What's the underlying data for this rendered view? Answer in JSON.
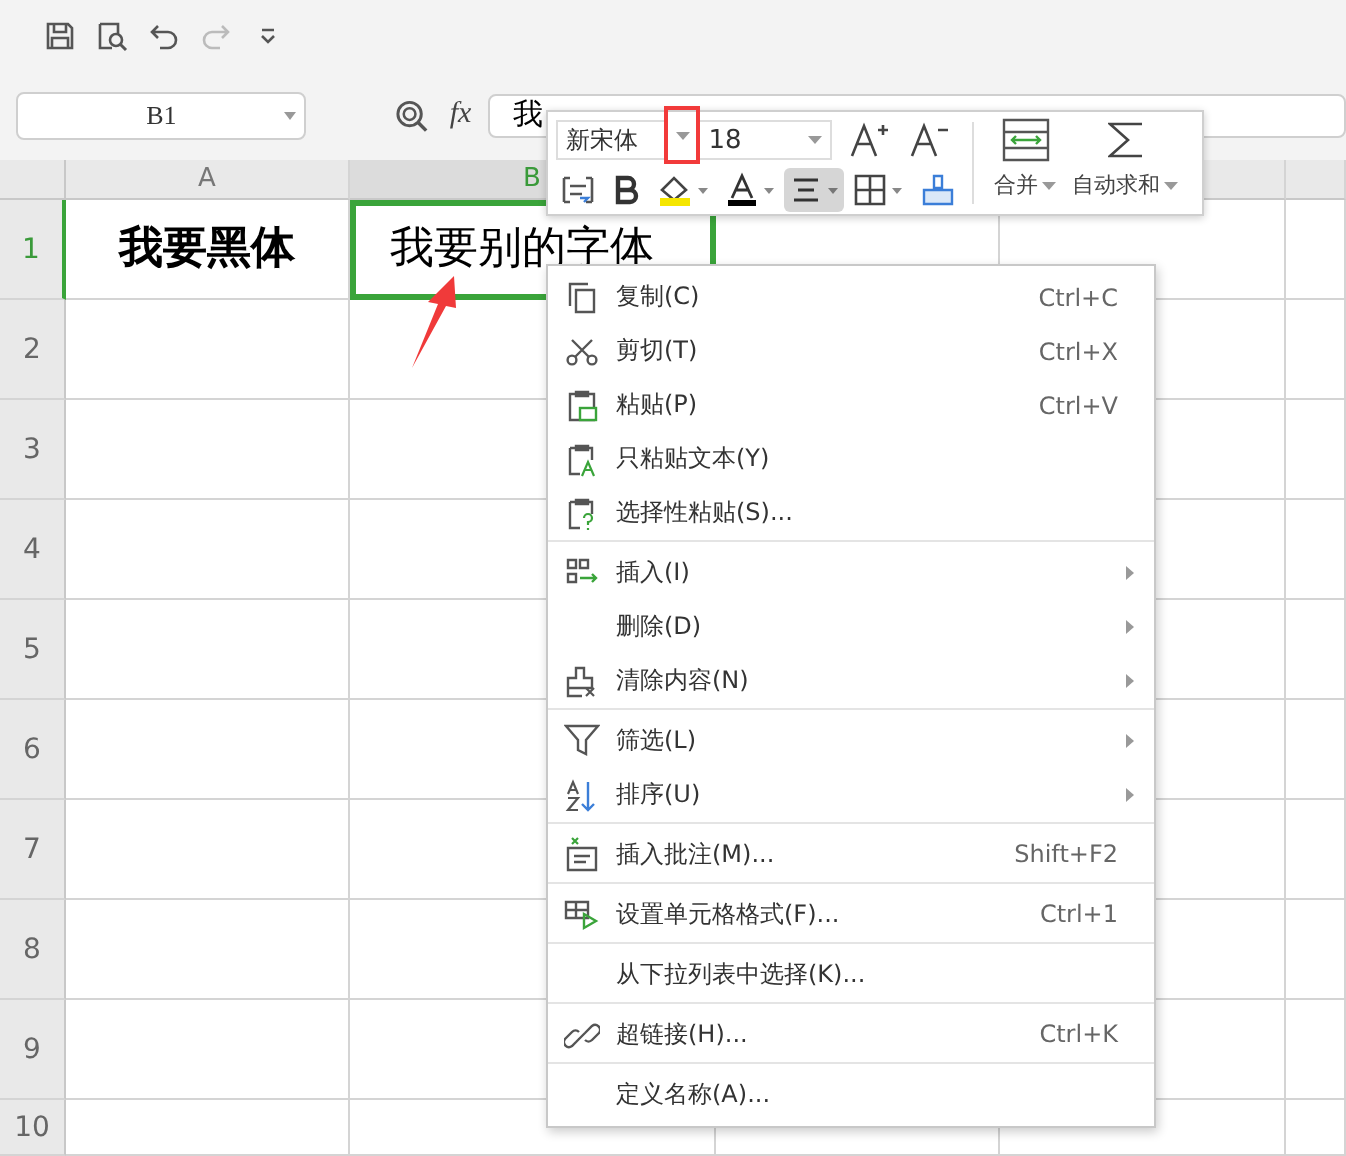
{
  "name_box": {
    "value": "B1"
  },
  "formula_bar": {
    "fx": "fx",
    "value": "我"
  },
  "columns": [
    {
      "label": "A",
      "selected": false
    },
    {
      "label": "B",
      "selected": true
    }
  ],
  "rows": [
    {
      "label": "1",
      "selected": true,
      "cells": [
        {
          "text": "我要黑体",
          "bold": true,
          "selected": false
        },
        {
          "text": "我要别的字体",
          "bold": false,
          "selected": true
        }
      ]
    },
    {
      "label": "2",
      "selected": false
    },
    {
      "label": "3",
      "selected": false
    },
    {
      "label": "4",
      "selected": false
    },
    {
      "label": "5",
      "selected": false
    },
    {
      "label": "6",
      "selected": false
    },
    {
      "label": "7",
      "selected": false
    },
    {
      "label": "8",
      "selected": false
    },
    {
      "label": "9",
      "selected": false
    },
    {
      "label": "10",
      "selected": false
    }
  ],
  "mini_toolbar": {
    "font": "新宋体",
    "size": "18",
    "merge_label": "合并",
    "sum_label": "自动求和",
    "align_pressed": true
  },
  "context_menu": [
    {
      "label": "复制(C)",
      "shortcut": "Ctrl+C",
      "submenu": false,
      "divider_before": false
    },
    {
      "label": "剪切(T)",
      "shortcut": "Ctrl+X",
      "submenu": false,
      "divider_before": false
    },
    {
      "label": "粘贴(P)",
      "shortcut": "Ctrl+V",
      "submenu": false,
      "divider_before": false
    },
    {
      "label": "只粘贴文本(Y)",
      "submenu": false,
      "divider_before": false
    },
    {
      "label": "选择性粘贴(S)...",
      "submenu": false,
      "divider_before": false
    },
    {
      "label": "插入(I)",
      "submenu": true,
      "divider_before": true
    },
    {
      "label": "删除(D)",
      "submenu": true,
      "divider_before": false
    },
    {
      "label": "清除内容(N)",
      "submenu": true,
      "divider_before": false
    },
    {
      "label": "筛选(L)",
      "submenu": true,
      "divider_before": true
    },
    {
      "label": "排序(U)",
      "submenu": true,
      "divider_before": false
    },
    {
      "label": "插入批注(M)...",
      "shortcut": "Shift+F2",
      "submenu": false,
      "divider_before": true
    },
    {
      "label": "设置单元格格式(F)...",
      "shortcut": "Ctrl+1",
      "submenu": false,
      "divider_before": true
    },
    {
      "label": "从下拉列表中选择(K)...",
      "submenu": false,
      "divider_before": true
    },
    {
      "label": "超链接(H)...",
      "shortcut": "Ctrl+K",
      "submenu": false,
      "divider_before": true
    },
    {
      "label": "定义名称(A)...",
      "submenu": false,
      "divider_before": true
    }
  ]
}
